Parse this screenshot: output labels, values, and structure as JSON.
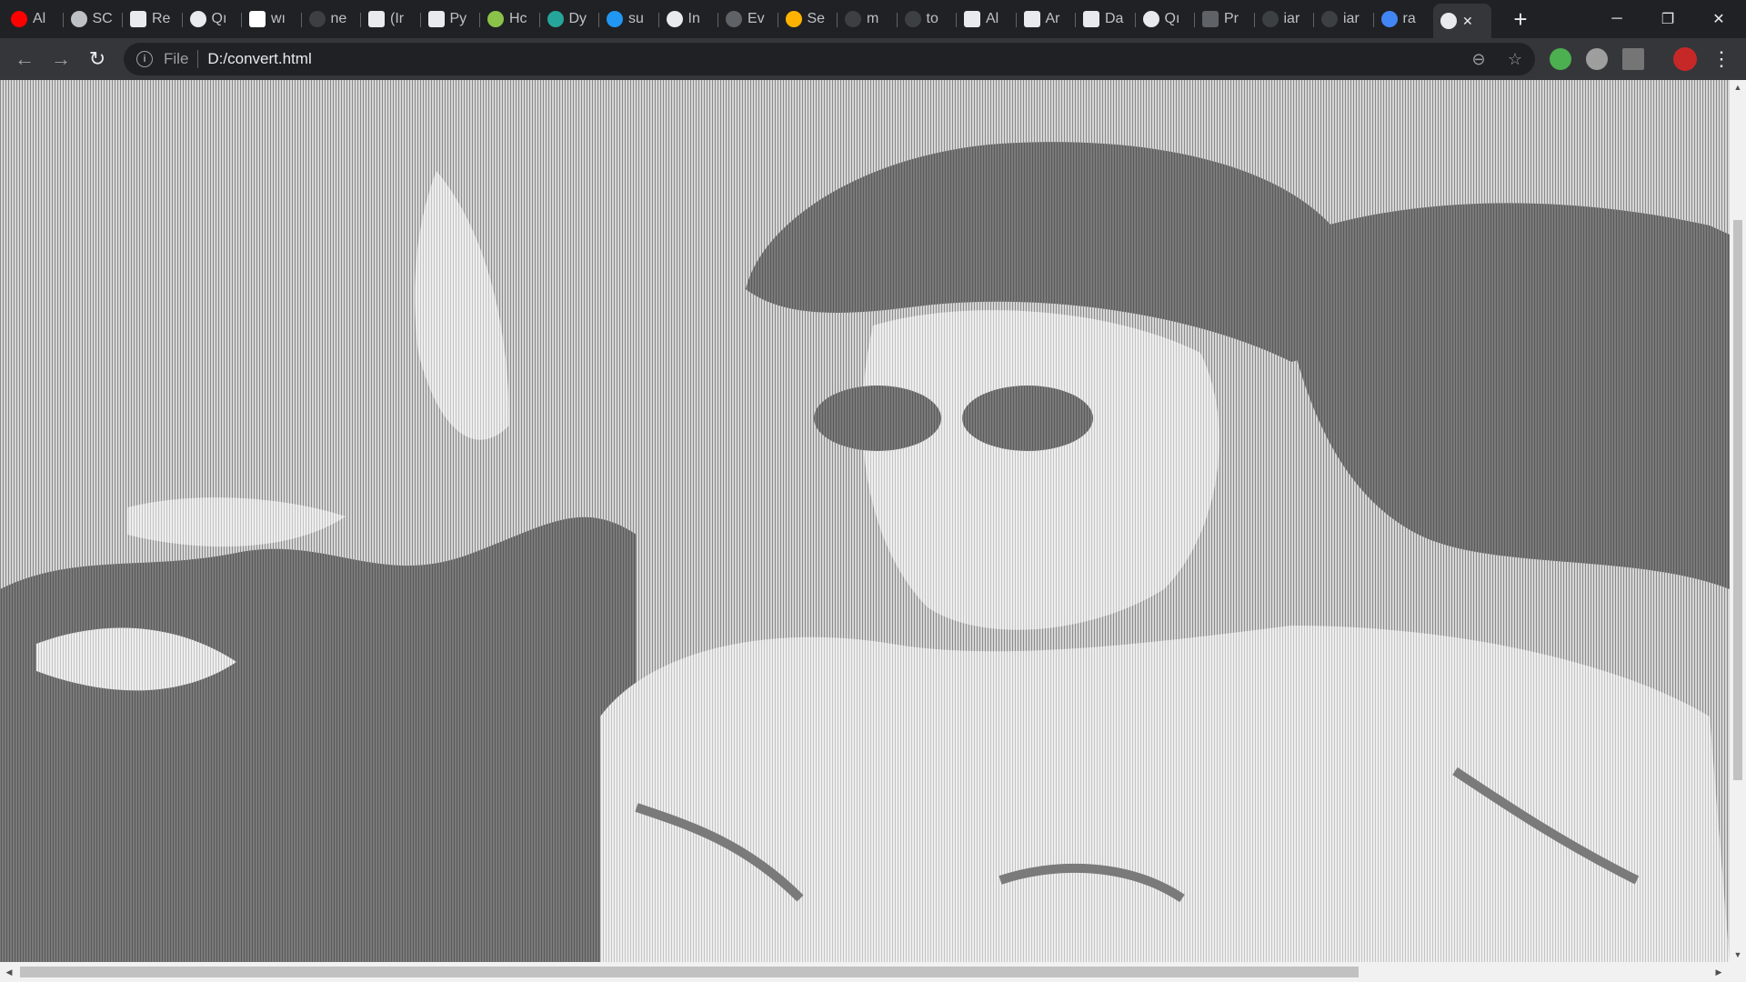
{
  "browser": {
    "tabs": [
      {
        "title": "Al",
        "icon": "youtube-icon",
        "color": "#ff0000"
      },
      {
        "title": "SC",
        "icon": "database-icon",
        "color": "#bdc1c6"
      },
      {
        "title": "Re",
        "icon": "hand-icon",
        "color": "#e8eaed"
      },
      {
        "title": "Qı",
        "icon": "globe-icon",
        "color": "#e8eaed"
      },
      {
        "title": "wı",
        "icon": "chart-icon",
        "color": "#ffffff"
      },
      {
        "title": "ne",
        "icon": "github-icon",
        "color": "#3c4043"
      },
      {
        "title": "(Ir",
        "icon": "hand-icon",
        "color": "#e8eaed"
      },
      {
        "title": "Py",
        "icon": "hand-icon",
        "color": "#e8eaed"
      },
      {
        "title": "Hc",
        "icon": "arrow-icon",
        "color": "#8bc34a"
      },
      {
        "title": "Dy",
        "icon": "r-logo-icon",
        "color": "#26a69a"
      },
      {
        "title": "su",
        "icon": "k-logo-icon",
        "color": "#2196f3"
      },
      {
        "title": "In",
        "icon": "globe-icon",
        "color": "#e8eaed"
      },
      {
        "title": "Ev",
        "icon": "triangle-icon",
        "color": "#5f6368"
      },
      {
        "title": "Se",
        "icon": "headset-icon",
        "color": "#ffb300"
      },
      {
        "title": "m",
        "icon": "github-icon",
        "color": "#3c4043"
      },
      {
        "title": "to",
        "icon": "github-icon",
        "color": "#3c4043"
      },
      {
        "title": "Al",
        "icon": "hand-icon",
        "color": "#e8eaed"
      },
      {
        "title": "Ar",
        "icon": "hand-icon",
        "color": "#e8eaed"
      },
      {
        "title": "Da",
        "icon": "hand-icon",
        "color": "#e8eaed"
      },
      {
        "title": "Qı",
        "icon": "globe-icon",
        "color": "#e8eaed"
      },
      {
        "title": "Pr",
        "icon": "laptop-icon",
        "color": "#5f6368"
      },
      {
        "title": "iar",
        "icon": "github-icon",
        "color": "#3c4043"
      },
      {
        "title": "iar",
        "icon": "github-icon",
        "color": "#3c4043"
      },
      {
        "title": "ra",
        "icon": "google-icon",
        "color": "#4285f4"
      }
    ],
    "active_tab": {
      "icon": "globe-icon",
      "close": "✕"
    },
    "new_tab": "+",
    "window": {
      "minimize": "─",
      "maximize": "❐",
      "close": "✕"
    },
    "nav": {
      "back": "←",
      "forward": "→",
      "reload": "↻"
    },
    "address": {
      "scheme_label": "File",
      "url": "D:/convert.html",
      "info": "i"
    },
    "omni_actions": {
      "zoom": "⊖",
      "bookmark": "☆"
    },
    "extensions": [
      {
        "name": "extension-1-icon",
        "color": "#4caf50"
      },
      {
        "name": "extension-2-icon",
        "color": "#9e9e9e"
      },
      {
        "name": "extension-3-icon",
        "color": "#757575"
      }
    ],
    "profile_color": "#c62828",
    "menu": "⋮"
  },
  "page": {
    "description_hidden": "",
    "colors": {
      "dark": "#6e6e6e",
      "mid": "#a8a8a8",
      "light": "#dcdcdc",
      "white": "#f6f6f6"
    }
  }
}
